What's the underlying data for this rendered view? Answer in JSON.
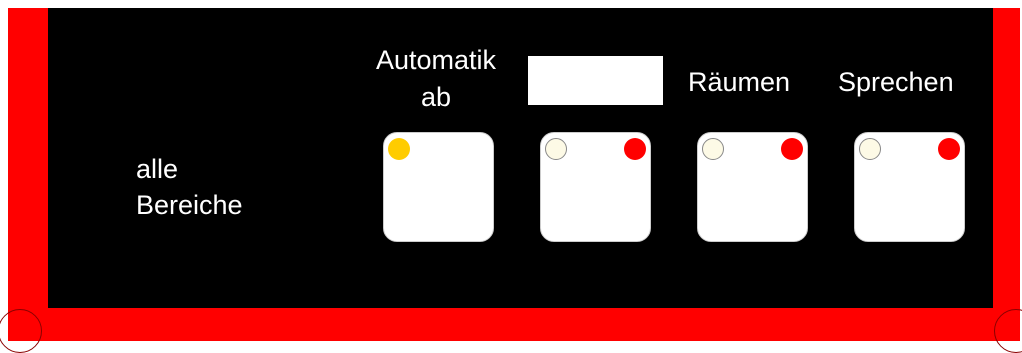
{
  "labels": {
    "alle": "alle",
    "bereiche": "Bereiche",
    "automatik": "Automatik",
    "ab": "ab",
    "raeumen": "Räumen",
    "sprechen": "Sprechen"
  },
  "colors": {
    "frame": "#ff0000",
    "panel": "#000000",
    "led_yellow": "#ffcc00",
    "led_off": "#fdfae6",
    "led_red": "#ff0000"
  },
  "buttons": [
    {
      "id": "automatik-ab",
      "left_led": "yellow-on",
      "right_led": "none"
    },
    {
      "id": "blank-display",
      "left_led": "off",
      "right_led": "red-on"
    },
    {
      "id": "raeumen",
      "left_led": "off",
      "right_led": "red-on"
    },
    {
      "id": "sprechen",
      "left_led": "off",
      "right_led": "red-on"
    }
  ]
}
